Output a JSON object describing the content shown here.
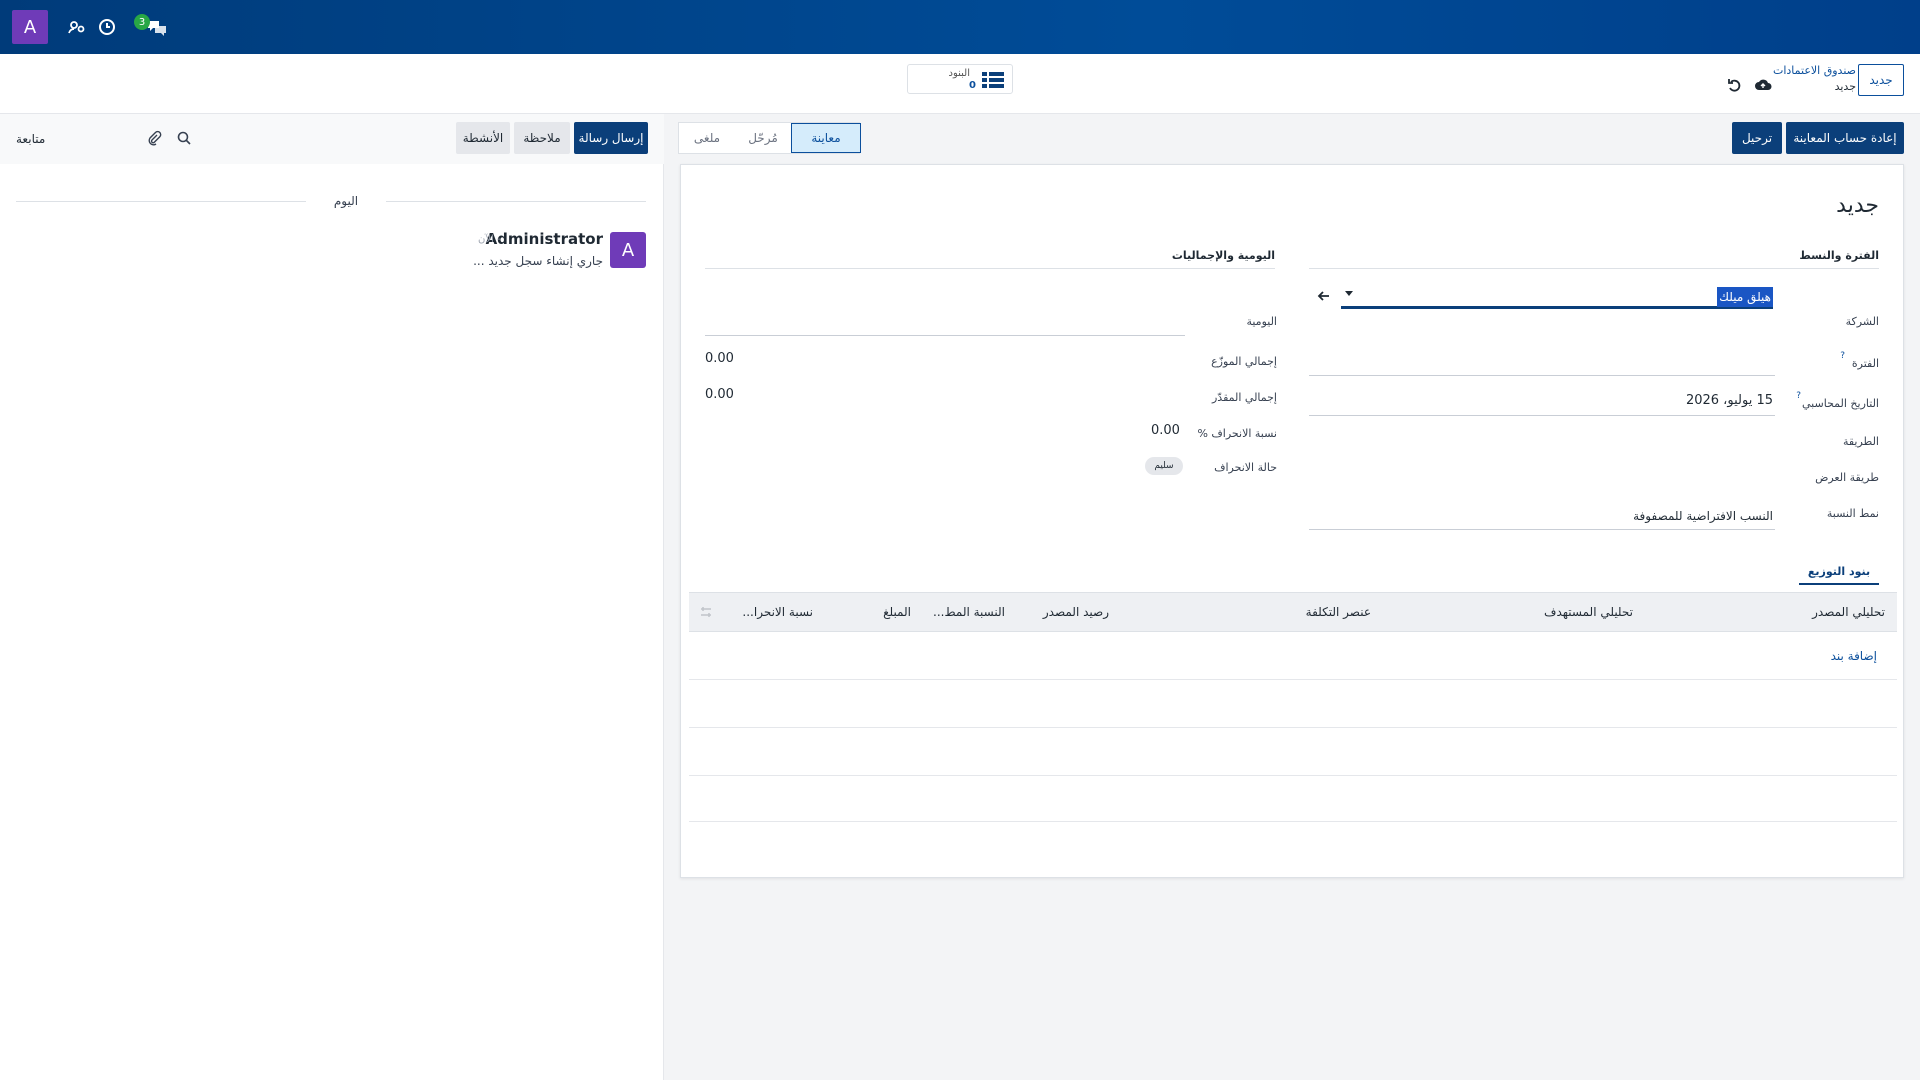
{
  "topbar": {
    "avatar_letter": "A",
    "icons": [
      "users-gear-icon",
      "clock-icon",
      "chat-icon"
    ],
    "chat_badge": "3"
  },
  "control": {
    "new_button": "جديد",
    "breadcrumb_parent": "صندوق الاعتمادات",
    "breadcrumb_current": "جديد",
    "lines_label": "البنود",
    "lines_count": "0"
  },
  "actions": {
    "recompute_preview": "إعادة حساب المعاينة",
    "post": "ترحيل"
  },
  "status": {
    "stages": [
      "معاينة",
      "مُرحّل",
      "ملغى"
    ],
    "active": "معاينة"
  },
  "form": {
    "title": "جديد",
    "section_period": "الفترة والنسط",
    "section_journal": "اليومية والإجماليات",
    "company_label": "الشركة",
    "company_value": "هيلق ميلك",
    "period_label": "الفترة",
    "period_value": "",
    "accounting_date_label": "التاريخ المحاسبي",
    "accounting_date_value": "15 يوليو، 2026",
    "method_label": "الطريقة",
    "display_method_label": "طريقة العرض",
    "ratio_pattern_label": "نمط النسبة",
    "ratio_pattern_value": "النسب الافتراضية للمصفوفة",
    "journal_label": "اليومية",
    "journal_value": "",
    "total_distributed_label": "إجمالي الموزّع",
    "total_distributed_value": "0.00",
    "total_estimated_label": "إجمالي المقدّر",
    "total_estimated_value": "0.00",
    "deviation_pct_label": "نسبة الانحراف %",
    "deviation_pct_value": "0.00",
    "deviation_status_label": "حالة الانحراف",
    "deviation_status_value": "سليم",
    "tip_mark": "?"
  },
  "lines_tab": {
    "tab_label": "بنود التوزيع",
    "columns": [
      "تحليلي المصدر",
      "تحليلي المستهدف",
      "عنصر التكلفة",
      "رصيد المصدر",
      "النسبة المط...",
      "المبلغ",
      "نسبة الانحرا..."
    ],
    "add_line": "إضافة بند"
  },
  "chatter": {
    "send_message": "إرسال رسالة",
    "note": "ملاحظة",
    "activities": "الأنشطة",
    "follow": "متابعة",
    "day": "اليوم",
    "message": {
      "avatar_letter": "A",
      "author": "Administrator",
      "time": "- الآن",
      "body": "جاري إنشاء سجل جديد ..."
    }
  },
  "colors": {
    "brand": "#004c98",
    "primary_button": "#0b3f7a",
    "avatar": "#6f3bb8",
    "badge": "#28a745"
  }
}
